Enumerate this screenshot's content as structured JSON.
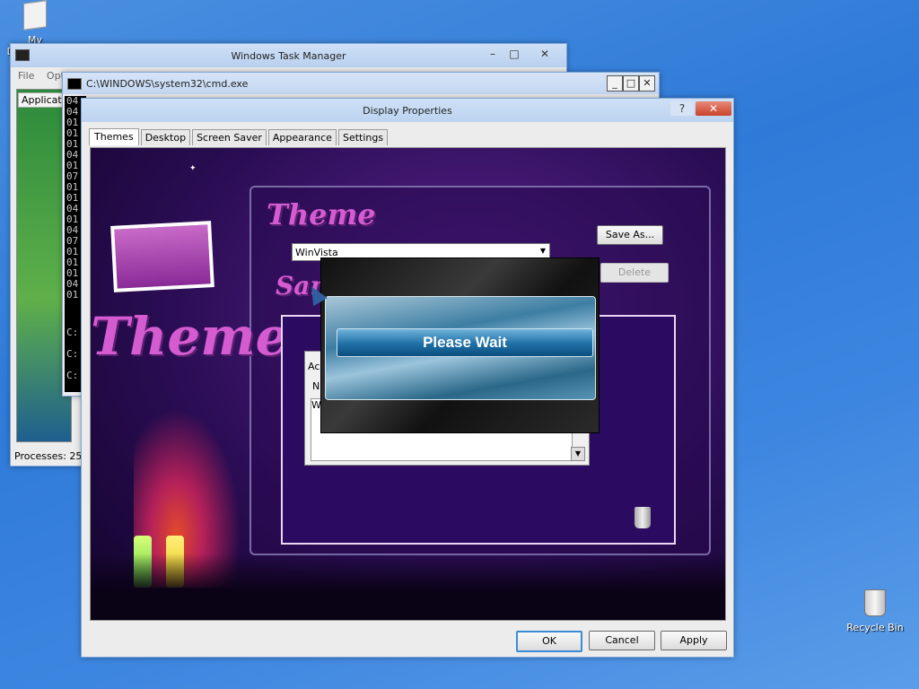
{
  "desktop": {
    "icons": [
      {
        "label": "My Documents"
      },
      {
        "label": "Recycle Bin"
      }
    ]
  },
  "taskmgr": {
    "title": "Windows Task Manager",
    "menu_file": "File",
    "menu_options": "Opti",
    "tab_applications": "Applicati",
    "status": "Processes: 25"
  },
  "cmd": {
    "title": "C:\\WINDOWS\\system32\\cmd.exe",
    "lines": [
      "04",
      "04",
      "01",
      "01",
      "01",
      "04",
      "01",
      "07",
      "01",
      "01",
      "04",
      "01",
      "04",
      "07",
      "01",
      "01",
      "01",
      "04",
      "01"
    ],
    "prompts": [
      "C:",
      "C:",
      "C:"
    ]
  },
  "display": {
    "title": "Display Properties",
    "tabs": [
      "Themes",
      "Desktop",
      "Screen Saver",
      "Appearance",
      "Settings"
    ],
    "theme_heading": "Theme",
    "themes_word": "Themes",
    "sample_word": "Sam",
    "theme_select_value": "WinVista",
    "save_as": "Save As...",
    "delete": "Delete",
    "sample_tab": "Ac",
    "sample_col": "N",
    "sample_item": "W",
    "ok": "OK",
    "cancel": "Cancel",
    "apply": "Apply"
  },
  "wait": {
    "message": "Please Wait"
  },
  "colors": {
    "desktop": "#2f7ad8",
    "accent_purple": "#d45bd0",
    "wait_bar": "#1f6fa5"
  }
}
